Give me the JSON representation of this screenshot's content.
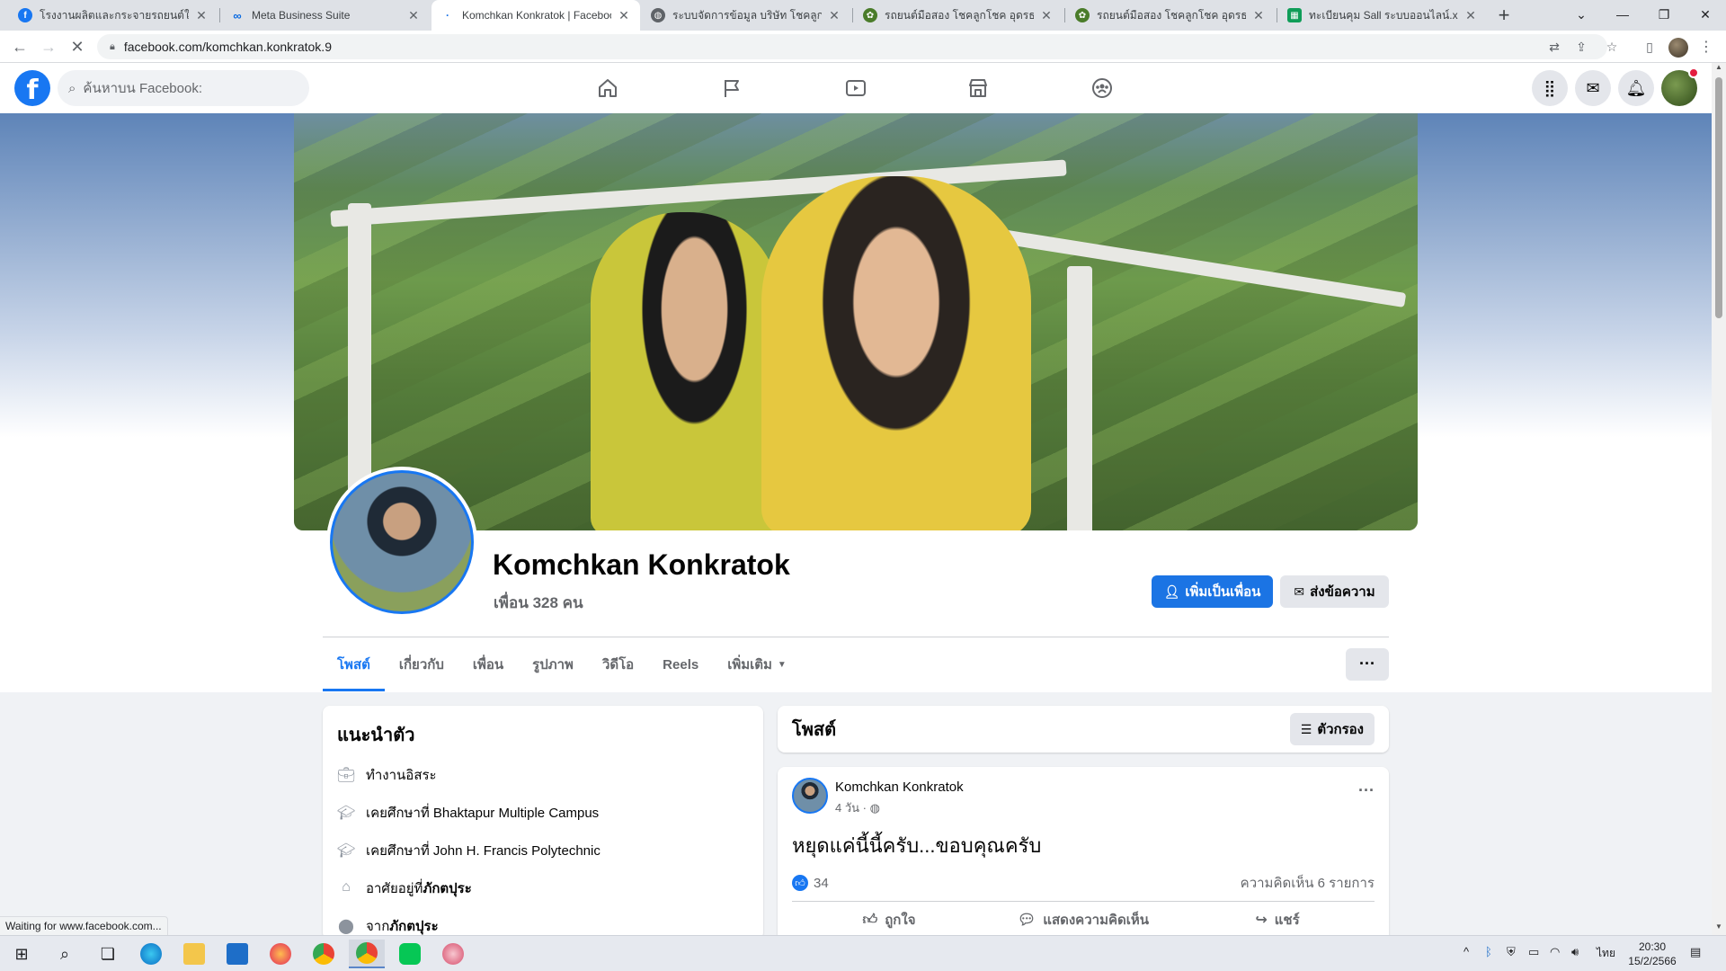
{
  "browser": {
    "tabs": [
      {
        "label": "โรงงานผลิตและกระจายรถยนต์ใช้แล้ว",
        "favicon_color": "#1877f2"
      },
      {
        "label": "Meta Business Suite",
        "favicon_color": "#0668e1"
      },
      {
        "label": "Komchkan Konkratok | Facebook",
        "favicon_color": "#1877f2"
      },
      {
        "label": "ระบบจัดการข้อมูล บริษัท โชคลูกโชค",
        "favicon_color": "#5f6368"
      },
      {
        "label": "รถยนต์มือสอง โชคลูกโชค อุดรธานี",
        "favicon_color": "#4a7c2a"
      },
      {
        "label": "รถยนต์มือสอง โชคลูกโชค อุดรธานี",
        "favicon_color": "#4a7c2a"
      },
      {
        "label": "ทะเบียนคุม Sall ระบบออนไลน์.xlsx - G",
        "favicon_color": "#0f9d58"
      }
    ],
    "url": "facebook.com/komchkan.konkratok.9",
    "status": "Waiting for www.facebook.com..."
  },
  "fb": {
    "search_placeholder": "ค้นหาบน Facebook:",
    "nav": [
      "home-icon",
      "flag-icon",
      "video-icon",
      "marketplace-icon",
      "groups-icon"
    ]
  },
  "profile": {
    "name": "Komchkan Konkratok",
    "friends": "เพื่อน 328 คน",
    "add_friend": "เพิ่มเป็นเพื่อน",
    "message": "ส่งข้อความ",
    "tabs": [
      "โพสต์",
      "เกี่ยวกับ",
      "เพื่อน",
      "รูปภาพ",
      "วิดีโอ",
      "Reels",
      "เพิ่มเติม"
    ],
    "more_label": "···"
  },
  "intro": {
    "title": "แนะนำตัว",
    "items": [
      {
        "prefix": "ทำงานอิสระ",
        "bold": ""
      },
      {
        "prefix": "เคยศึกษาที่ Bhaktapur Multiple Campus",
        "bold": ""
      },
      {
        "prefix": "เคยศึกษาที่ John H. Francis Polytechnic",
        "bold": ""
      },
      {
        "prefix": "อาศัยอยู่ที่ ",
        "bold": "ภักตปุระ"
      },
      {
        "prefix": "จาก ",
        "bold": "ภักตปุระ"
      }
    ]
  },
  "posts": {
    "title": "โพสต์",
    "filter": "ตัวกรอง",
    "post": {
      "author": "Komchkan Konkratok",
      "time": "4 วัน · ",
      "text": "หยุดแค่นี้นี้ครับ...ขอบคุณครับ",
      "likes": "34",
      "comments": "ความคิดเห็น 6 รายการ",
      "actions": [
        "ถูกใจ",
        "แสดงความคิดเห็น",
        "แชร์"
      ]
    }
  },
  "taskbar": {
    "clock_time": "20:30",
    "clock_date": "15/2/2566",
    "lang": "ไทย"
  }
}
